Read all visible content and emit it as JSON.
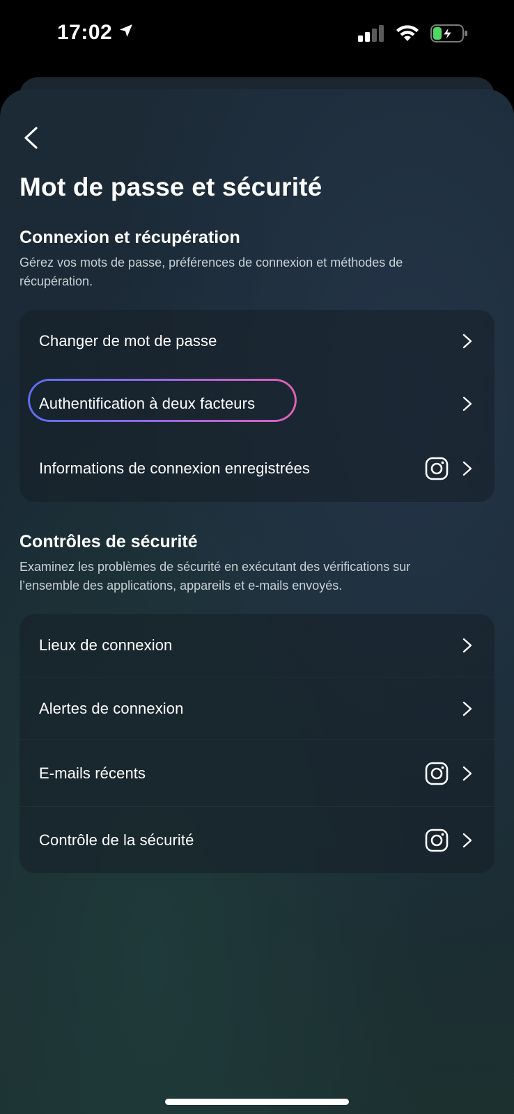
{
  "status_bar": {
    "time": "17:02",
    "location_icon": "location-arrow-icon",
    "signal_icon": "cellular-signal-icon",
    "wifi_icon": "wifi-icon",
    "battery_icon": "battery-charging-icon",
    "battery_color": "#4cd964"
  },
  "page": {
    "back_icon": "chevron-left-icon",
    "title": "Mot de passe et sécurité"
  },
  "login_section": {
    "heading": "Connexion et récupération",
    "description": "Gérez vos mots de passe, préférences de connexion et méthodes de récupération.",
    "items": [
      {
        "label": "Changer de mot de passe",
        "has_instagram_icon": false,
        "highlighted": false
      },
      {
        "label": "Authentification à deux facteurs",
        "has_instagram_icon": false,
        "highlighted": true
      },
      {
        "label": "Informations de connexion enregistrées",
        "has_instagram_icon": true,
        "highlighted": false
      }
    ]
  },
  "security_section": {
    "heading": "Contrôles de sécurité",
    "description": "Examinez les problèmes de sécurité en exécutant des vérifications sur l’ensemble des applications, appareils et e-mails envoyés.",
    "items": [
      {
        "label": "Lieux de connexion",
        "has_instagram_icon": false
      },
      {
        "label": "Alertes de connexion",
        "has_instagram_icon": false
      },
      {
        "label": "E-mails récents",
        "has_instagram_icon": true
      },
      {
        "label": "Contrôle de la sécurité",
        "has_instagram_icon": true
      }
    ]
  },
  "colors": {
    "highlight_gradient_start": "#5e6df3",
    "highlight_gradient_end": "#e362b9"
  }
}
